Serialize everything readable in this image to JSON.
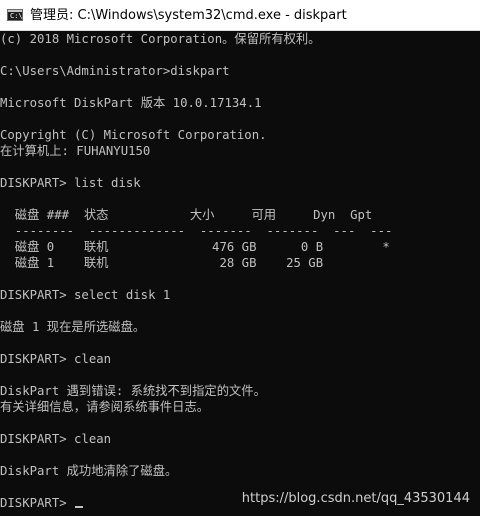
{
  "window": {
    "icon": "cmd-icon",
    "title": "管理员: C:\\Windows\\system32\\cmd.exe - diskpart"
  },
  "console": {
    "lines": [
      "(c) 2018 Microsoft Corporation。保留所有权利。",
      "",
      "C:\\Users\\Administrator>diskpart",
      "",
      "Microsoft DiskPart 版本 10.0.17134.1",
      "",
      "Copyright (C) Microsoft Corporation.",
      "在计算机上: FUHANYU150",
      "",
      "DISKPART> list disk",
      "",
      "  磁盘 ###  状态           大小     可用     Dyn  Gpt",
      "  --------  -------------  -------  -------  ---  ---",
      "  磁盘 0    联机              476 GB      0 B        *",
      "  磁盘 1    联机               28 GB    25 GB",
      "",
      "DISKPART> select disk 1",
      "",
      "磁盘 1 现在是所选磁盘。",
      "",
      "DISKPART> clean",
      "",
      "DiskPart 遇到错误: 系统找不到指定的文件。",
      "有关详细信息，请参阅系统事件日志。",
      "",
      "DISKPART> clean",
      "",
      "DiskPart 成功地清除了磁盘。",
      "",
      "DISKPART> "
    ]
  },
  "watermark": "https://blog.csdn.net/qq_43530144",
  "colors": {
    "console_background": "#0c0c0c",
    "console_text": "#c0c0c0",
    "titlebar_background": "#ffffff"
  }
}
